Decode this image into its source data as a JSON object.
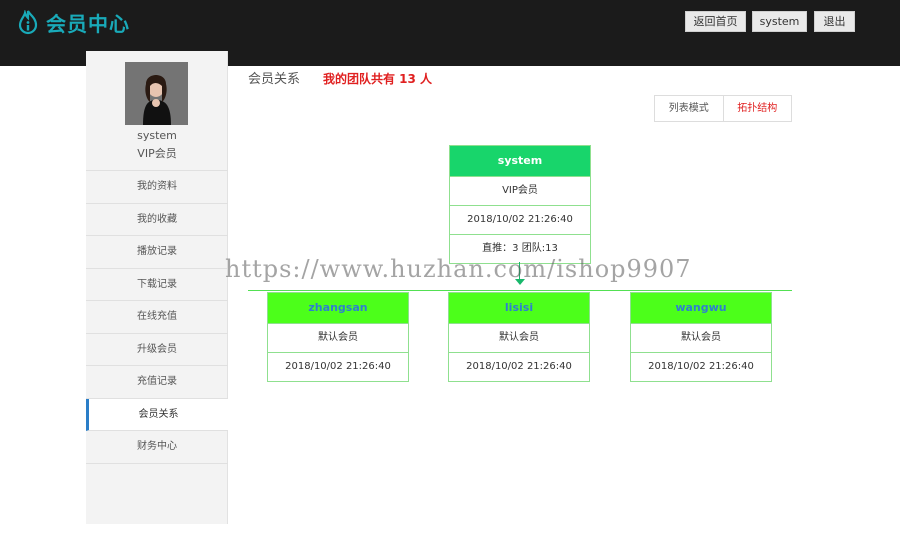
{
  "header": {
    "logo_text": "会员中心",
    "logo_icon": "info-flame-icon",
    "buttons": {
      "home": "返回首页",
      "user": "system",
      "logout": "退出"
    },
    "accent": "#19aab9"
  },
  "sidebar": {
    "username": "system",
    "level": "VIP会员",
    "items": [
      {
        "label": "我的资料"
      },
      {
        "label": "我的收藏"
      },
      {
        "label": "播放记录"
      },
      {
        "label": "下载记录"
      },
      {
        "label": "在线充值"
      },
      {
        "label": "升级会员"
      },
      {
        "label": "充值记录"
      },
      {
        "label": "会员关系"
      },
      {
        "label": "财务中心"
      }
    ],
    "active_item": "会员关系"
  },
  "main": {
    "title": "会员关系",
    "team_count": "我的团队共有 13 人",
    "view_tabs": {
      "list": "列表模式",
      "tree": "拓扑结构"
    },
    "root": {
      "name": "system",
      "level": "VIP会员",
      "date": "2018/10/02 21:26:40",
      "stats": "直推：3  团队:13"
    },
    "children": [
      {
        "name": "zhangsan",
        "level": "默认会员",
        "date": "2018/10/02 21:26:40"
      },
      {
        "name": "lisisi",
        "level": "默认会员",
        "date": "2018/10/02 21:26:40"
      },
      {
        "name": "wangwu",
        "level": "默认会员",
        "date": "2018/10/02 21:26:40"
      }
    ]
  },
  "watermark": "https://www.huzhan.com/ishop9907",
  "colors": {
    "root_header": "#18d56b",
    "child_header": "#4cff1a",
    "active_tab": "#e02020",
    "sidebar_active_border": "#2a7ec8"
  }
}
